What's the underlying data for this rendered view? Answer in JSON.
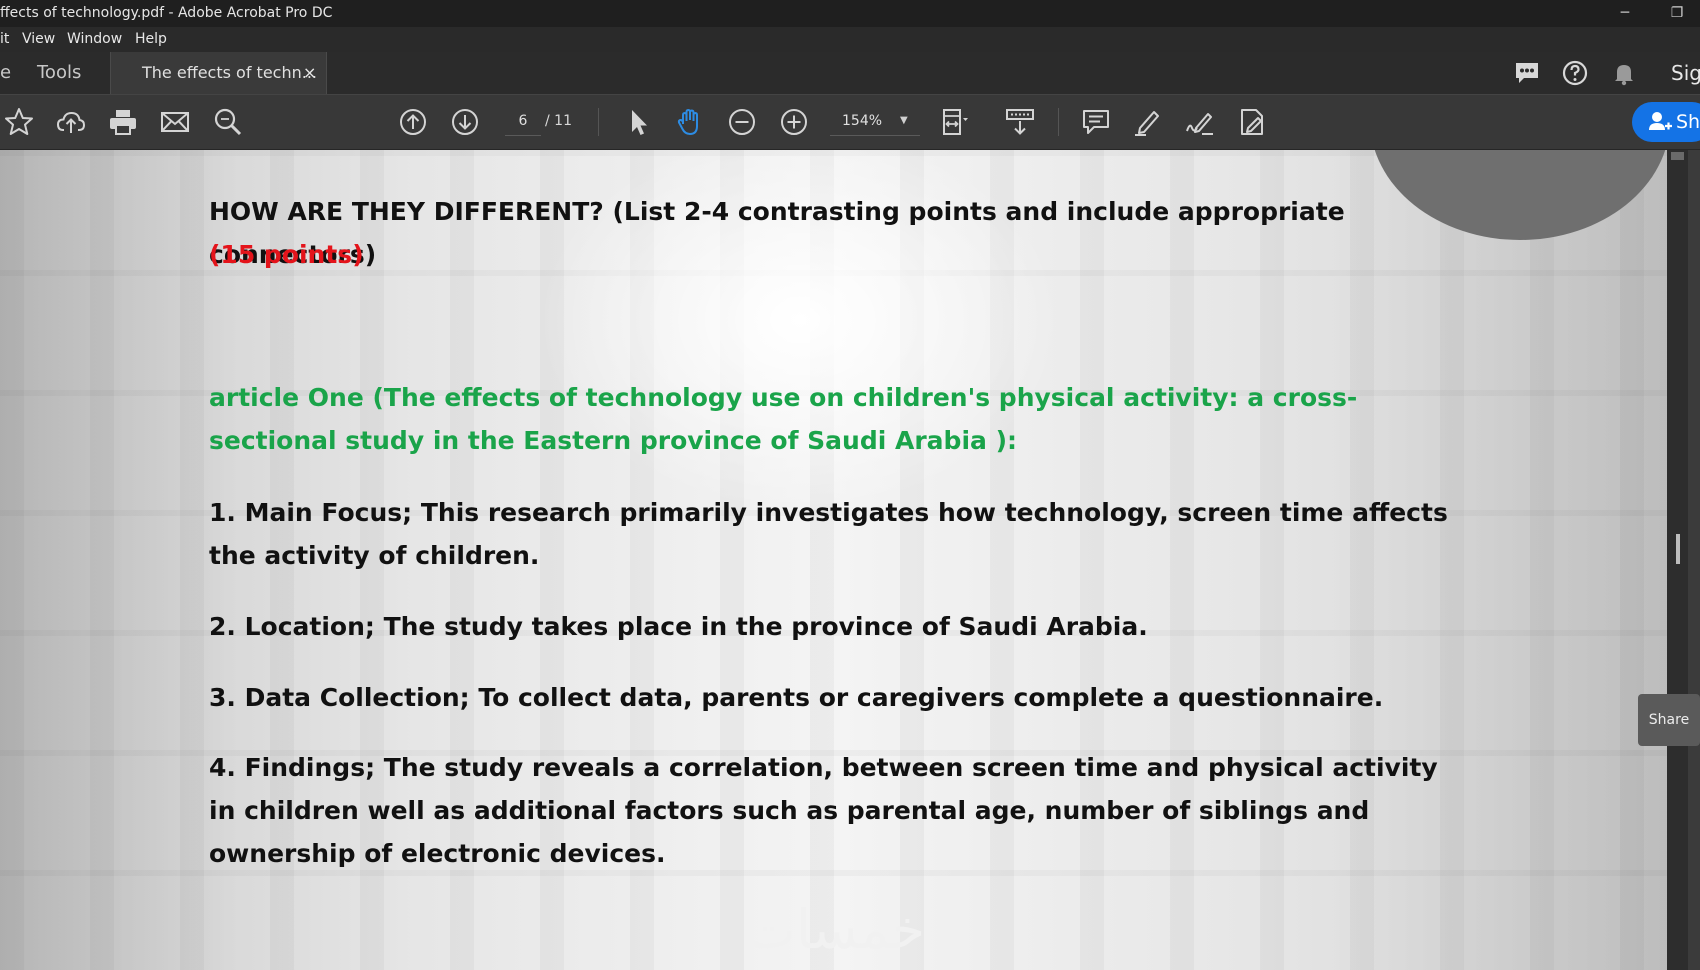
{
  "window": {
    "title": "ffects of technology.pdf - Adobe Acrobat Pro DC"
  },
  "menu": {
    "items": [
      "it",
      "View",
      "Window",
      "Help"
    ]
  },
  "tabs": {
    "left_fragment": "e",
    "tools": "Tools",
    "document": "The effects of techn...",
    "close": "×",
    "sign": "Sig"
  },
  "toolbar": {
    "page_current": "6",
    "page_total": "/ 11",
    "zoom": "154%",
    "share": "Sh"
  },
  "document": {
    "heading": "HOW ARE THEY DIFFERENT?  (List 2-4 contrasting points and include appropriate connectors)",
    "points": "(15 points)",
    "article_title": "article One (The effects of technology use on children's physical activity: a cross-sectional study in the Eastern province of Saudi Arabia ):",
    "item1": "1. Main Focus; This research primarily investigates how technology, screen time affects the activity of children.",
    "item2": "2. Location; The study takes place in the province of Saudi Arabia.",
    "item3": "3. Data Collection; To collect data, parents or caregivers complete a questionnaire.",
    "item4": "4. Findings; The study reveals a correlation, between screen time and physical activity in children well as additional factors such as parental age, number of siblings and ownership of electronic devices.",
    "watermark": "خمسات"
  },
  "side_share": "Share",
  "colors": {
    "accent": "#1473e6",
    "red_text": "#e4141b",
    "green_text": "#1aa44a",
    "hand_tool": "#2d8ce3"
  },
  "icons": [
    "star-icon",
    "upload-cloud-icon",
    "print-icon",
    "mail-icon",
    "zoom-search-icon",
    "page-up-icon",
    "page-down-icon",
    "select-cursor-icon",
    "hand-icon",
    "zoom-out-icon",
    "zoom-in-icon",
    "fit-page-icon",
    "scroll-mode-icon",
    "comment-icon",
    "highlight-icon",
    "sign-icon",
    "edit-icon",
    "chat-icon",
    "help-icon",
    "bell-icon",
    "add-user-icon"
  ]
}
